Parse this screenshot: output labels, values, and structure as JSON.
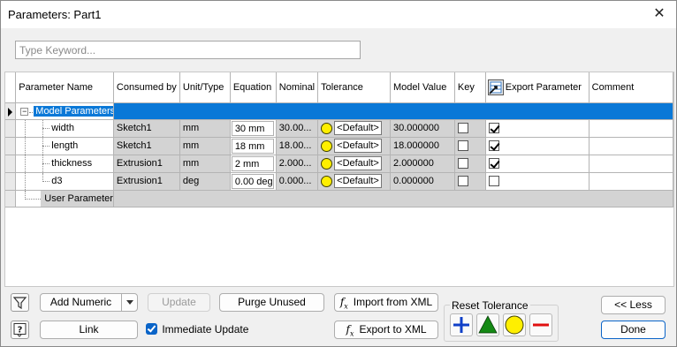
{
  "window": {
    "title": "Parameters: Part1"
  },
  "search": {
    "placeholder": "Type Keyword..."
  },
  "grid": {
    "columns": [
      "Parameter Name",
      "Consumed by",
      "Unit/Type",
      "Equation",
      "Nominal",
      "Tolerance",
      "Model Value",
      "Key",
      "Export Parameter",
      "Comment"
    ],
    "groups": {
      "model": "Model Parameters",
      "user": "User Parameters"
    },
    "rows": [
      {
        "name": "width",
        "consumed_by": "Sketch1",
        "unit": "mm",
        "equation": "30 mm",
        "nominal": "30.00...",
        "tolerance": "<Default>",
        "model_value": "30.000000",
        "key": false,
        "export": true
      },
      {
        "name": "length",
        "consumed_by": "Sketch1",
        "unit": "mm",
        "equation": "18 mm",
        "nominal": "18.00...",
        "tolerance": "<Default>",
        "model_value": "18.000000",
        "key": false,
        "export": true
      },
      {
        "name": "thickness",
        "consumed_by": "Extrusion1",
        "unit": "mm",
        "equation": "2 mm",
        "nominal": "2.000...",
        "tolerance": "<Default>",
        "model_value": "2.000000",
        "key": false,
        "export": true
      },
      {
        "name": "d3",
        "consumed_by": "Extrusion1",
        "unit": "deg",
        "equation": "0.00 deg",
        "nominal": "0.000...",
        "tolerance": "<Default>",
        "model_value": "0.000000",
        "key": false,
        "export": false
      }
    ]
  },
  "buttons": {
    "add_numeric": "Add Numeric",
    "update": "Update",
    "purge_unused": "Purge Unused",
    "import_xml": "Import from XML",
    "link": "Link",
    "export_xml": "Export to XML",
    "less": "<< Less",
    "done": "Done"
  },
  "immediate_update": {
    "label": "Immediate Update",
    "checked": true
  },
  "reset_tolerance": {
    "label": "Reset Tolerance"
  },
  "colors": {
    "selection": "#0a78d7",
    "tol_plus": "#1040c8",
    "tol_triangle": "#158a15",
    "tol_circle": "#ffef00",
    "tol_minus": "#e01010"
  }
}
